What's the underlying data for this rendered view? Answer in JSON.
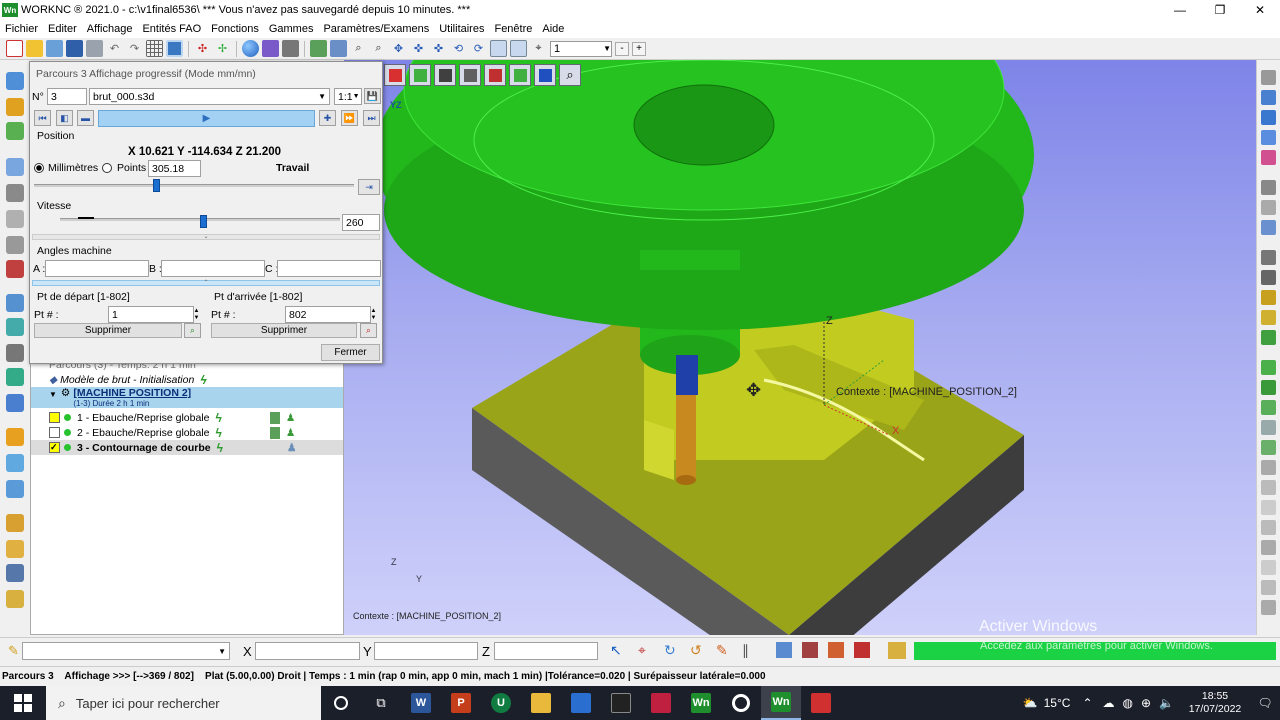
{
  "window": {
    "badge": "Wn",
    "title": "WORKNC ® 2021.0 - c:\\v1final6536\\ *** Vous n'avez pas sauvegardé depuis 10 minutes. ***",
    "minimize": "—",
    "maximize": "❐",
    "close": "✕"
  },
  "menu": [
    "Fichier",
    "Editer",
    "Affichage",
    "Entités FAO",
    "Fonctions",
    "Gammes",
    "Paramètres/Examens",
    "Utilitaires",
    "Fenêtre",
    "Aide"
  ],
  "toolbar": {
    "layer_value": "1",
    "minus": "-",
    "plus": "+"
  },
  "dialog": {
    "title": "Parcours 3 Affichage progressif (Mode mm/mn)",
    "num_label": "N° :",
    "num_value": "3",
    "file_value": "brut_000.s3d",
    "scale_value": "1:1",
    "position_header": "Position",
    "coordinates": "X 10.621 Y -114.634 Z 21.200",
    "radio_mm": "Millimètres",
    "radio_points": "Points",
    "points_value": "305.18",
    "mode_label": "Travail",
    "progress_fraction": 0.38,
    "speed_header": "Vitesse",
    "speed_value": "260",
    "speed_fraction": 0.51,
    "angles_header": "Angles machine",
    "angle_a_label": "A :",
    "angle_b_label": "B :",
    "angle_c_label": "C :",
    "start_header": "Pt de départ [1-802]",
    "end_header": "Pt d'arrivée [1-802]",
    "pt_label": "Pt # :",
    "start_value": "1",
    "end_value": "802",
    "delete_label": "Supprimer",
    "close_label": "Fermer"
  },
  "tree": {
    "partial_row": "Parcours (3) - Temps: 2 h 1 min",
    "stock_model": "Modèle de brut - Initialisation",
    "group_name": "[MACHINE POSITION 2]",
    "group_sub": "(1-3) Durée 2 h 1 min",
    "items": [
      {
        "label": "1 - Ebauche/Reprise globale",
        "checked": false
      },
      {
        "label": "2 - Ebauche/Reprise globale",
        "checked": false
      },
      {
        "label": "3 - Contournage de courbe",
        "checked": true
      }
    ]
  },
  "viewport": {
    "context_label": "Contexte : [MACHINE_POSITION_2]",
    "context_bottom": "Contexte : [MACHINE_POSITION_2]",
    "axis_z": "Z",
    "axis_x": "X",
    "triad_z": "Z",
    "triad_y": "Y",
    "yz_badge": "YZ",
    "watermark": "Activer Windows",
    "colors": {
      "tool_green": "#22b81c",
      "part_yellow": "#b8c212",
      "base_gray": "#5a5a5a"
    }
  },
  "coordbar": {
    "x_label": "X",
    "y_label": "Y",
    "z_label": "Z",
    "watermark": "Accédez aux paramètres pour activer Windows."
  },
  "status": {
    "text": "Parcours 3    Affichage >>> [-->369 / 802]    Plat (5.00,0.00) Droit | Temps : 1 min (rap 0 min, app 0 min, mach 1 min) |Tolérance=0.020 | Surépaisseur latérale=0.000"
  },
  "taskbar": {
    "search_placeholder": "Taper ici pour rechercher",
    "temperature": "15°C",
    "time": "18:55",
    "date": "17/07/2022"
  }
}
